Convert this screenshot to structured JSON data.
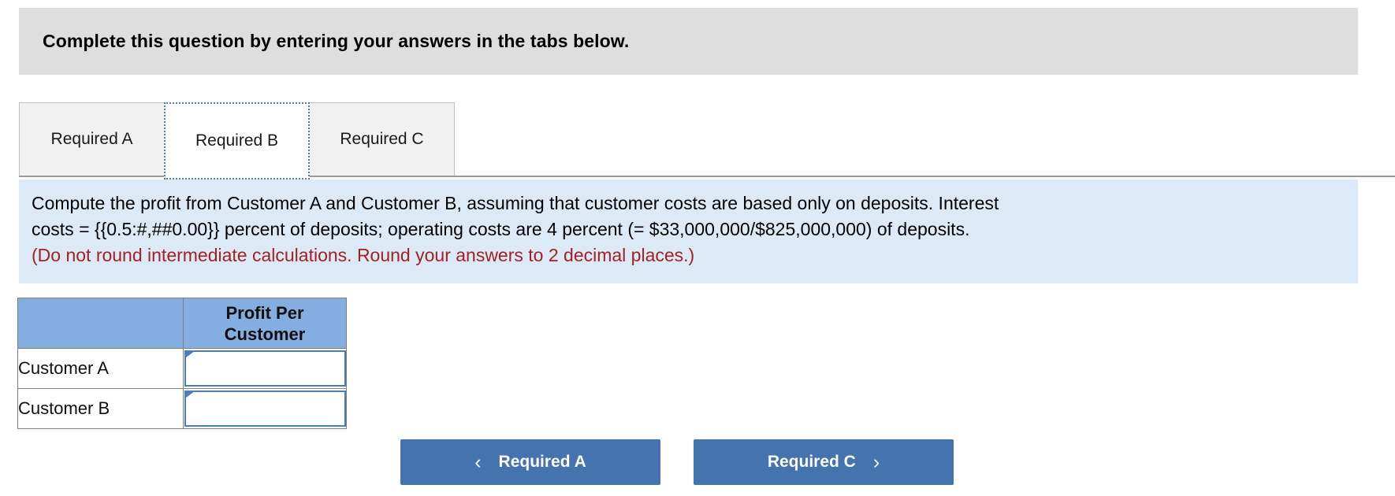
{
  "header": {
    "title": "Complete this question by entering your answers in the tabs below."
  },
  "tabs": [
    {
      "label": "Required A",
      "active": false
    },
    {
      "label": "Required B",
      "active": true
    },
    {
      "label": "Required C",
      "active": false
    }
  ],
  "question": {
    "line1": "Compute the profit from Customer A and Customer B, assuming that customer costs are based only on deposits. Interest",
    "line2": "costs = {{0.5:#,##0.00}} percent of deposits; operating costs are 4 percent (= $33,000,000/$825,000,000) of deposits.",
    "note": "(Do not round intermediate calculations. Round your answers to 2 decimal places.)"
  },
  "table": {
    "headers": [
      "",
      "Profit Per Customer"
    ],
    "rows": [
      {
        "label": "Customer A",
        "value": "",
        "placeholder": ""
      },
      {
        "label": "Customer B",
        "value": "",
        "placeholder": ""
      }
    ]
  },
  "nav": {
    "prev_label": "Required A",
    "next_label": "Required C",
    "prev_chevron": "‹",
    "next_chevron": "›"
  },
  "colors": {
    "header_bg": "#dedede",
    "info_bg": "#dceaf8",
    "note_text": "#a32121",
    "table_header_bg": "#85aee0",
    "button_bg": "#4473ae",
    "focus_border": "#4a7ebb"
  }
}
